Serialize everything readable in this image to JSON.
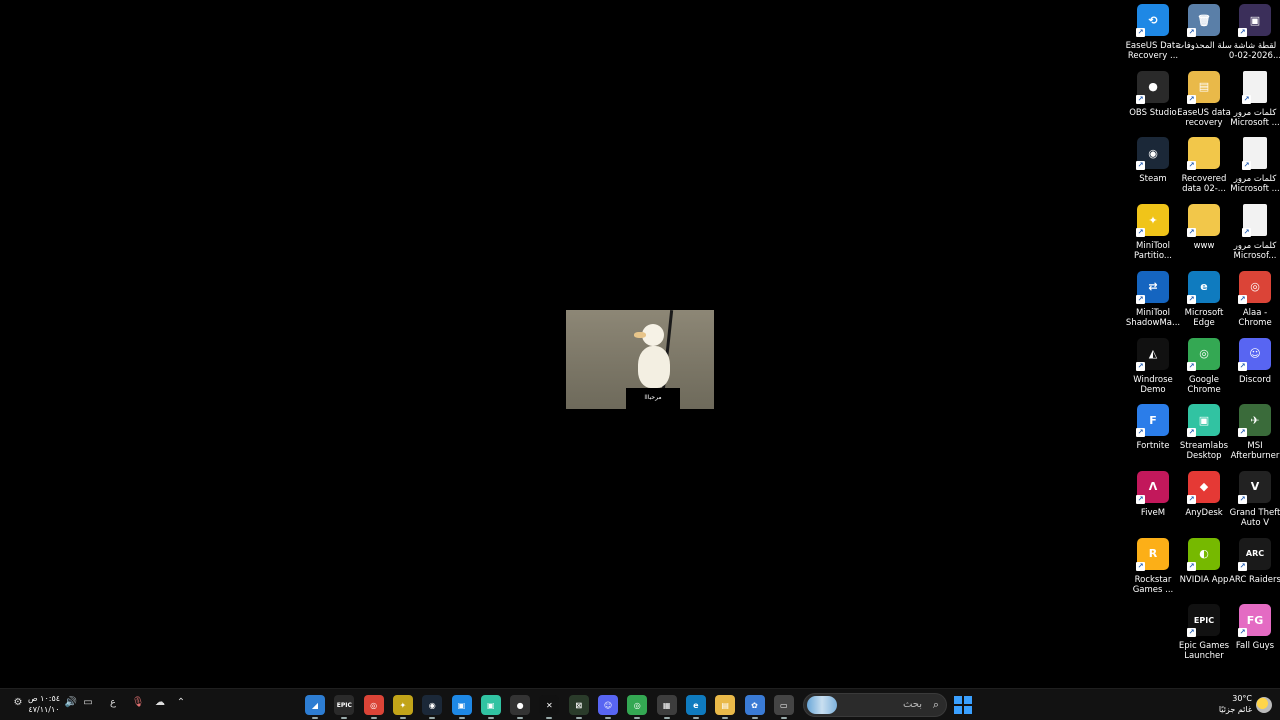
{
  "desktop": {
    "icons": [
      {
        "id": "easeus-recovery",
        "label": "EaseUS Data Recovery ...",
        "color": "#1e88e5",
        "glyph": "⟲",
        "col": 0,
        "row": 0
      },
      {
        "id": "recycle-bin",
        "label": "سلة المحذوفات",
        "color": "#5a7fa8",
        "glyph": "🗑",
        "col": 1,
        "row": 0
      },
      {
        "id": "screenshot",
        "label": "لقطة شاشة 2026-02-0...",
        "color": "#3b2f5a",
        "glyph": "▣",
        "col": 2,
        "row": 0
      },
      {
        "id": "obs-studio",
        "label": "OBS Studio",
        "color": "#2a2a2a",
        "glyph": "●",
        "col": 0,
        "row": 1
      },
      {
        "id": "easeus-folder",
        "label": "EaseUS data recovery",
        "color": "#e9b949",
        "glyph": "▤",
        "col": 1,
        "row": 1
      },
      {
        "id": "passwords-1",
        "label": "كلمات مرور Microsoft ...",
        "color": "#f2f2f2",
        "glyph": "",
        "col": 2,
        "row": 1
      },
      {
        "id": "steam",
        "label": "Steam",
        "color": "#1b2838",
        "glyph": "◉",
        "col": 0,
        "row": 2
      },
      {
        "id": "recovered-data",
        "label": "Recovered data 02-...",
        "color": "#f2c74a",
        "glyph": "",
        "col": 1,
        "row": 2
      },
      {
        "id": "passwords-2",
        "label": "كلمات مرور Microsoft ...",
        "color": "#f2f2f2",
        "glyph": "",
        "col": 2,
        "row": 2
      },
      {
        "id": "minitool-partition",
        "label": "MiniTool Partitio...",
        "color": "#f0c419",
        "glyph": "✦",
        "col": 0,
        "row": 3
      },
      {
        "id": "www-folder",
        "label": "www",
        "color": "#f2c74a",
        "glyph": "",
        "col": 1,
        "row": 3
      },
      {
        "id": "passwords-3",
        "label": "كلمات مرور Microsof...",
        "color": "#f2f2f2",
        "glyph": "",
        "col": 2,
        "row": 3
      },
      {
        "id": "minitool-shadow",
        "label": "MiniTool ShadowMa...",
        "color": "#1565c0",
        "glyph": "⇄",
        "col": 0,
        "row": 4
      },
      {
        "id": "microsoft-edge",
        "label": "Microsoft Edge",
        "color": "#0f7bbf",
        "glyph": "e",
        "col": 1,
        "row": 4
      },
      {
        "id": "alaa-chrome",
        "label": "Alaa - Chrome",
        "color": "#db4437",
        "glyph": "◎",
        "col": 2,
        "row": 4
      },
      {
        "id": "windrose-demo",
        "label": "Windrose Demo",
        "color": "#111111",
        "glyph": "◭",
        "col": 0,
        "row": 5
      },
      {
        "id": "google-chrome",
        "label": "Google Chrome",
        "color": "#34a853",
        "glyph": "◎",
        "col": 1,
        "row": 5
      },
      {
        "id": "discord",
        "label": "Discord",
        "color": "#5865f2",
        "glyph": "☺",
        "col": 2,
        "row": 5
      },
      {
        "id": "fortnite",
        "label": "Fortnite",
        "color": "#2b7de9",
        "glyph": "F",
        "col": 0,
        "row": 6
      },
      {
        "id": "streamlabs",
        "label": "Streamlabs Desktop",
        "color": "#31c3a2",
        "glyph": "▣",
        "col": 1,
        "row": 6
      },
      {
        "id": "msi-afterburner",
        "label": "MSI Afterburner",
        "color": "#3a6b3a",
        "glyph": "✈",
        "col": 2,
        "row": 6
      },
      {
        "id": "fivem",
        "label": "FiveM",
        "color": "#c2185b",
        "glyph": "Λ",
        "col": 0,
        "row": 7
      },
      {
        "id": "anydesk",
        "label": "AnyDesk",
        "color": "#e53935",
        "glyph": "◆",
        "col": 1,
        "row": 7
      },
      {
        "id": "gta-v",
        "label": "Grand Theft Auto V",
        "color": "#222222",
        "glyph": "V",
        "col": 2,
        "row": 7
      },
      {
        "id": "rockstar",
        "label": "Rockstar Games ...",
        "color": "#fcaf17",
        "glyph": "R",
        "col": 0,
        "row": 8
      },
      {
        "id": "nvidia-app",
        "label": "NVIDIA App",
        "color": "#76b900",
        "glyph": "◐",
        "col": 1,
        "row": 8
      },
      {
        "id": "arc-raiders",
        "label": "ARC Raiders",
        "color": "#1a1a1a",
        "glyph": "ARC",
        "col": 2,
        "row": 8
      },
      {
        "id": "epic-games",
        "label": "Epic Games Launcher",
        "color": "#111111",
        "glyph": "EPIC",
        "col": 1,
        "row": 9
      },
      {
        "id": "fall-guys",
        "label": "Fall Guys",
        "color": "#e46bc3",
        "glyph": "FG",
        "col": 2,
        "row": 9
      }
    ]
  },
  "image": {
    "caption": "مرحبااا"
  },
  "taskbar": {
    "clock_time": "١٠:٥٤ ص",
    "clock_date": "٤٧/١١/١٠",
    "language": "ع",
    "search_placeholder": "بحث",
    "weather_temp": "30°C",
    "weather_desc": "غائم جزئيًا",
    "apps": [
      {
        "id": "app-1",
        "glyph": "◢",
        "color": "#2d7dd2"
      },
      {
        "id": "epic",
        "glyph": "EPIC",
        "color": "#2a2a2a"
      },
      {
        "id": "chrome-active",
        "glyph": "◎",
        "color": "#db4437"
      },
      {
        "id": "minitool",
        "glyph": "✦",
        "color": "#c2a419"
      },
      {
        "id": "steam",
        "glyph": "◉",
        "color": "#1b2838"
      },
      {
        "id": "app-6",
        "glyph": "▣",
        "color": "#1e88e5"
      },
      {
        "id": "streamlabs",
        "glyph": "▣",
        "color": "#31c3a2"
      },
      {
        "id": "obs",
        "glyph": "●",
        "color": "#333333"
      },
      {
        "id": "x",
        "glyph": "✕",
        "color": "#111111"
      },
      {
        "id": "xbox",
        "glyph": "⊠",
        "color": "#2a3b2a"
      },
      {
        "id": "discord",
        "glyph": "☺",
        "color": "#5865f2"
      },
      {
        "id": "chrome",
        "glyph": "◎",
        "color": "#34a853"
      },
      {
        "id": "store",
        "glyph": "▦",
        "color": "#3d3d3d"
      },
      {
        "id": "edge",
        "glyph": "e",
        "color": "#0f7bbf"
      },
      {
        "id": "explorer",
        "glyph": "▤",
        "color": "#e9b949"
      },
      {
        "id": "copilot",
        "glyph": "✿",
        "color": "#3a7bd5"
      },
      {
        "id": "app-17",
        "glyph": "▭",
        "color": "#444444"
      }
    ]
  }
}
